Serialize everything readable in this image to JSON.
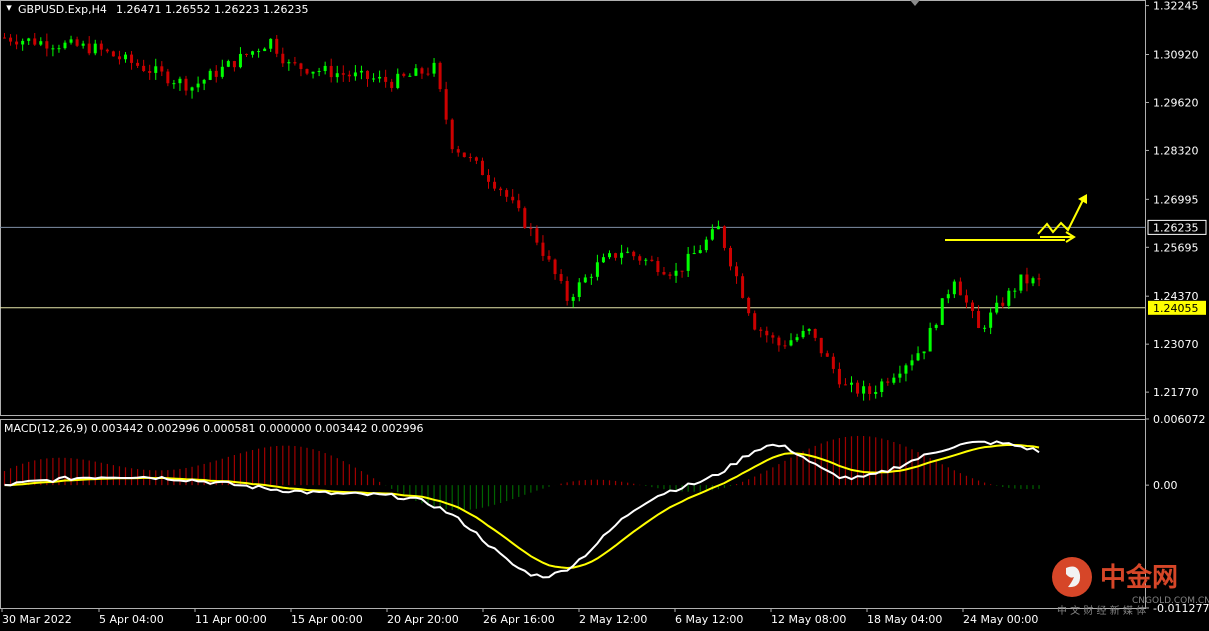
{
  "header": {
    "menu_arrow": "triangle-down-icon",
    "symbol": "GBPUSD.Exp,H4",
    "ohlc": "1.26471 1.26552 1.26223 1.26235"
  },
  "macd_header": "MACD(12,26,9) 0.003442 0.002996 0.000581 0.000000 0.003442 0.002996",
  "price_labels": [
    "1.32245",
    "1.30920",
    "1.29620",
    "1.28320",
    "1.26995",
    "1.25695",
    "1.24370",
    "1.23070",
    "1.21770"
  ],
  "current_price_label": "1.26235",
  "hline_price_label": "1.24055",
  "macd_labels": [
    "0.006072",
    "0.00",
    "-0.011277"
  ],
  "time_labels": [
    "30 Mar 2022",
    "5 Apr 04:00",
    "11 Apr 00:00",
    "15 Apr 00:00",
    "20 Apr 20:00",
    "26 Apr 16:00",
    "2 May 12:00",
    "6 May 12:00",
    "12 May 08:00",
    "18 May 04:00",
    "24 May 00:00"
  ],
  "watermark": {
    "logo": "cngold-logo-icon",
    "brand": "中金网",
    "domain": "CNGOLD.COM.CN",
    "tagline": "中 文 财 经 新 媒 体"
  },
  "colors": {
    "bull": "#00ff00",
    "bear": "#cc0000",
    "macd_main": "#ffffff",
    "macd_signal": "#ffff00",
    "hist_pos": "#a00000",
    "hist_neg": "#006400",
    "annotation": "#ffff00",
    "bid_line": "#7f8fa6",
    "hline": "#e6e6aa",
    "watermark": "#e24a2b"
  },
  "chart_data": {
    "type": "candlestick",
    "symbol": "GBPUSD.Exp",
    "timeframe": "H4",
    "price_range": [
      1.2115,
      1.3237
    ],
    "bid": 1.26235,
    "horizontal_line": 1.24055,
    "anchors": [
      {
        "date": "30 Mar 2022",
        "close": 1.3138
      },
      {
        "date": "5 Apr 04:00",
        "close": 1.3108
      },
      {
        "date": "11 Apr 00:00",
        "close": 1.3005
      },
      {
        "date": "13 Apr 12:00",
        "close": 1.313
      },
      {
        "date": "15 Apr 00:00",
        "close": 1.3063
      },
      {
        "date": "19 Apr 12:00",
        "close": 1.3017
      },
      {
        "date": "20 Apr 20:00",
        "close": 1.3055
      },
      {
        "date": "22 Apr 12:00",
        "close": 1.285
      },
      {
        "date": "25 Apr 04:00",
        "close": 1.273
      },
      {
        "date": "26 Apr 00:00",
        "close": 1.259
      },
      {
        "date": "27 Apr 04:00",
        "close": 1.243
      },
      {
        "date": "28 Apr 00:00",
        "close": 1.252
      },
      {
        "date": "29 Apr 12:00",
        "close": 1.256
      },
      {
        "date": "2 May 12:00",
        "close": 1.25
      },
      {
        "date": "5 May 00:00",
        "close": 1.262
      },
      {
        "date": "5 May 20:00",
        "close": 1.236
      },
      {
        "date": "9 May 04:00",
        "close": 1.2305
      },
      {
        "date": "10 May 12:00",
        "close": 1.234
      },
      {
        "date": "11 May 20:00",
        "close": 1.219
      },
      {
        "date": "13 May 00:00",
        "close": 1.2175
      },
      {
        "date": "16 May 16:00",
        "close": 1.23
      },
      {
        "date": "17 May 08:00",
        "close": 1.249
      },
      {
        "date": "18 May 04:00",
        "close": 1.2345
      },
      {
        "date": "19 May 08:00",
        "close": 1.248
      },
      {
        "date": "20 May 12:00",
        "close": 1.2475
      },
      {
        "date": "23 May 04:00",
        "close": 1.258
      },
      {
        "date": "24 May 00:00",
        "close": 1.253
      },
      {
        "date": "25 May 12:00",
        "close": 1.2575
      },
      {
        "date": "26 May 12:00",
        "close": 1.2623
      }
    ],
    "macd": {
      "params": "12,26,9",
      "value_range": [
        -0.011277,
        0.006072
      ],
      "main": 0.003442,
      "signal": 0.002996
    }
  }
}
